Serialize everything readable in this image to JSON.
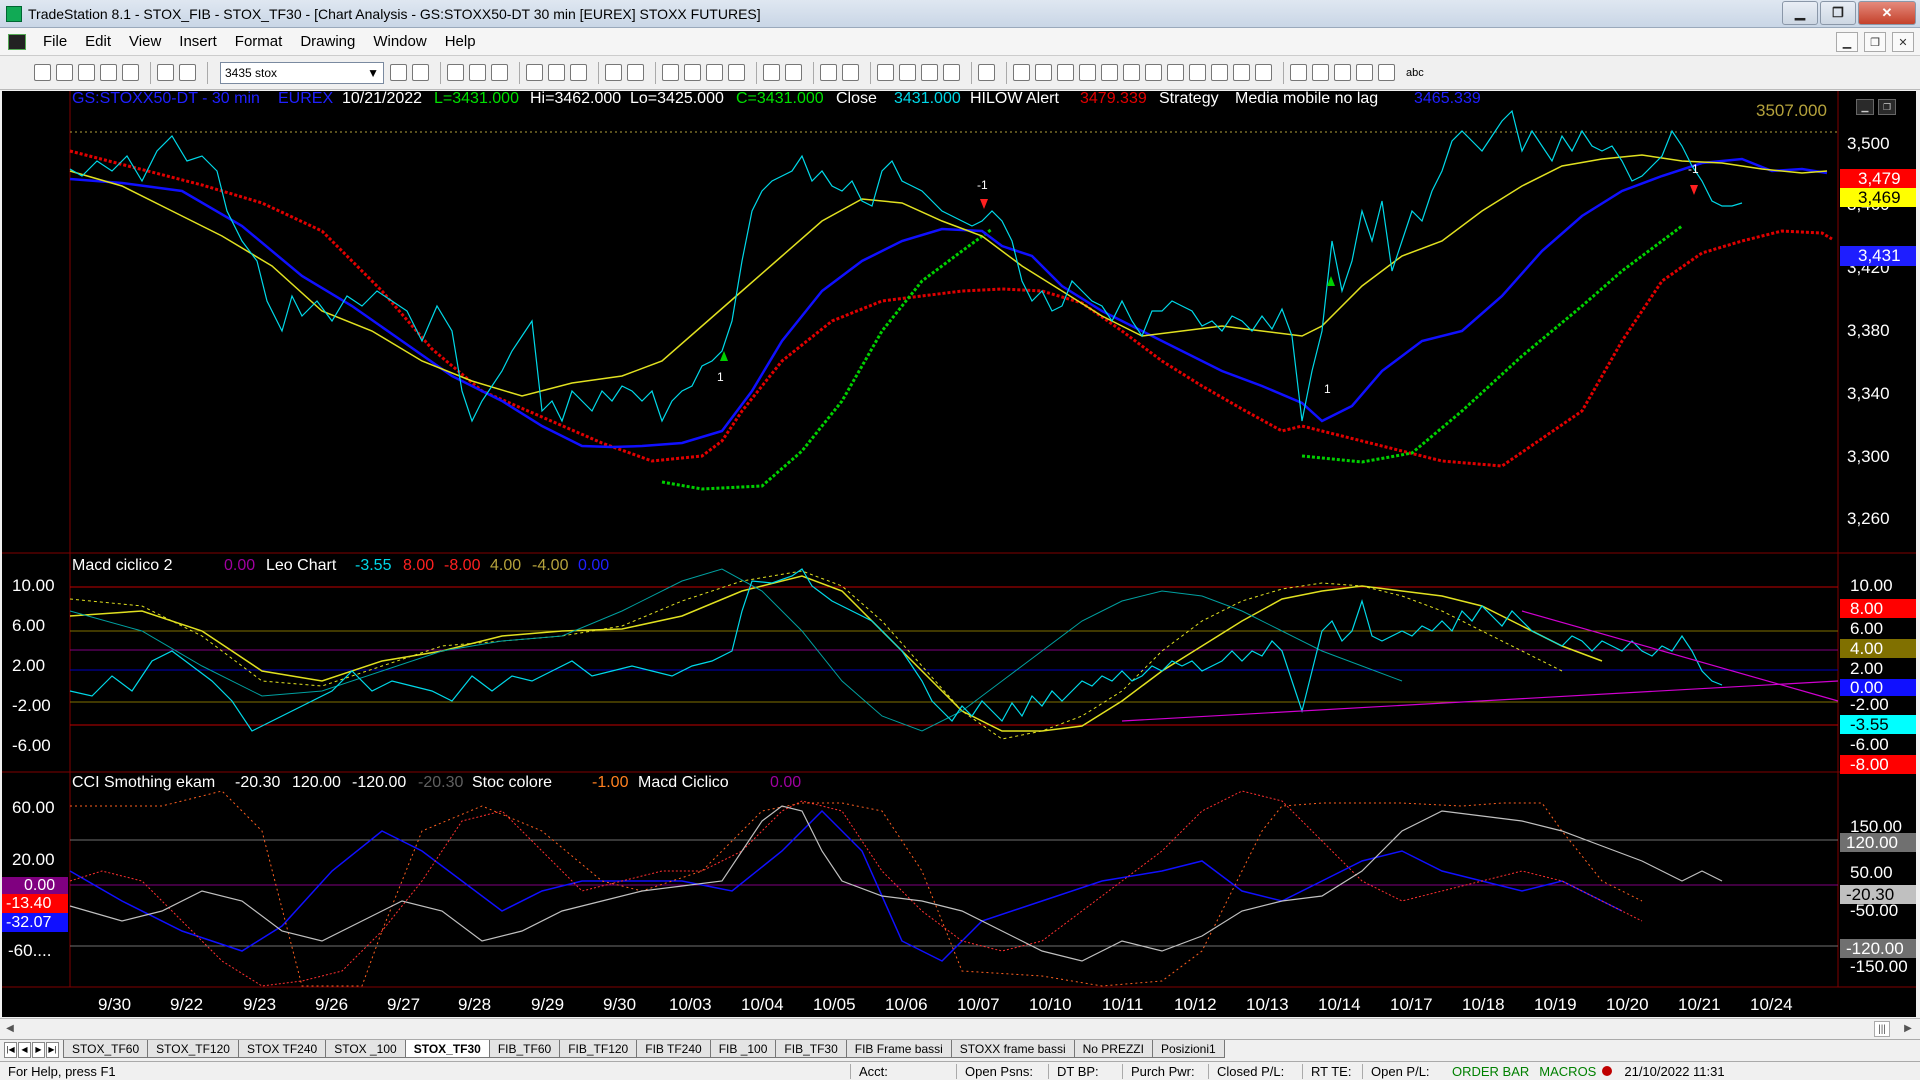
{
  "window": {
    "title": "TradeStation 8.1 - STOX_FIB - STOX_TF30 - [Chart Analysis - GS:STOXX50-DT  30 min  [EUREX] STOXX FUTURES]"
  },
  "menu": [
    "File",
    "Edit",
    "View",
    "Insert",
    "Format",
    "Drawing",
    "Window",
    "Help"
  ],
  "toolbar": {
    "symbol_value": "3435 stox",
    "text_tool": "abc"
  },
  "header": {
    "symbol": "GS:STOXX50-DT - 30 min",
    "exchange": "EUREX",
    "date": "10/21/2022",
    "last": "L=3431.000",
    "high": "Hi=3462.000",
    "low": "Lo=3425.000",
    "close_c": "C=3431.000",
    "close_label": "Close",
    "close_value": "3431.000",
    "hilow": "HILOW Alert",
    "hilow_value": "3479.339",
    "strategy": "Strategy",
    "media": "Media mobile no lag",
    "media_value": "3465.339",
    "topline_value": "3507.000"
  },
  "macd_header": {
    "name": "Macd ciclico 2",
    "v1": "0.00",
    "leo": "Leo Chart",
    "v2": "-3.55",
    "v3": "8.00",
    "v4": "-8.00",
    "v5": "4.00",
    "v6": "-4.00",
    "v7": "0.00"
  },
  "cci_header": {
    "name": "CCI Smothing ekam",
    "v1": "-20.30",
    "v2": "120.00",
    "v3": "-120.00",
    "v4": "-20.30",
    "stoc": "Stoc colore",
    "v5": "-1.00",
    "macd": "Macd Ciclico",
    "v6": "0.00"
  },
  "price_axis": [
    "3,500",
    "3,460",
    "3,420",
    "3,380",
    "3,340",
    "3,300",
    "3,260"
  ],
  "price_tags": {
    "red": "3,479",
    "yellow": "3,469",
    "blue": "3,431"
  },
  "macd_axis": [
    "10.00",
    "6.00",
    "2.00",
    "-2.00",
    "-6.00"
  ],
  "macd_tags": [
    "8.00",
    "4.00",
    "2.00",
    "0.00",
    "-2.00",
    "-3.55",
    "-6.00",
    "-8.00"
  ],
  "cci_axis": [
    "150.00",
    "120.00",
    "50.00",
    "-20.30",
    "-50.00",
    "-120.00",
    "-150.00"
  ],
  "cci_left_axis": [
    "60.00",
    "20.00",
    "-60...."
  ],
  "cci_left_tags": [
    "0.00",
    "-13.40",
    "-32.07"
  ],
  "time_axis": [
    "9/30",
    "9/22",
    "9/23",
    "9/26",
    "9/27",
    "9/28",
    "9/29",
    "9/30",
    "10/03",
    "10/04",
    "10/05",
    "10/06",
    "10/07",
    "10/10",
    "10/11",
    "10/12",
    "10/13",
    "10/14",
    "10/17",
    "10/18",
    "10/19",
    "10/20",
    "10/21",
    "10/24"
  ],
  "markers": {
    "buy": "1",
    "sell": "-1"
  },
  "tabs": [
    "STOX_TF60",
    "STOX_TF120",
    "STOX TF240",
    "STOX _100",
    "STOX_TF30",
    "FIB_TF60",
    "FIB_TF120",
    "FIB TF240",
    "FIB _100",
    "FIB_TF30",
    "FIB Frame bassi",
    "STOXX frame bassi",
    "No PREZZI",
    "Posizioni1"
  ],
  "active_tab": "STOX_TF30",
  "status": {
    "help": "For Help, press F1",
    "acct": "Acct:",
    "open_psns": "Open Psns:",
    "dt_bp": "DT BP:",
    "purch_pwr": "Purch Pwr:",
    "closed_pl": "Closed P/L:",
    "rt_te": "RT TE:",
    "open_pl": "Open P/L:",
    "orderbar": "ORDER BAR",
    "macros": "MACROS",
    "datetime": "21/10/2022 11:31"
  },
  "chart_data": {
    "type": "line",
    "title": "GS:STOXX50-DT - 30 min",
    "x": [
      "9/22",
      "9/23",
      "9/26",
      "9/27",
      "9/28",
      "9/29",
      "9/30",
      "10/03",
      "10/04",
      "10/05",
      "10/06",
      "10/07",
      "10/10",
      "10/11",
      "10/12",
      "10/13",
      "10/14",
      "10/17",
      "10/18",
      "10/19",
      "10/20",
      "10/21"
    ],
    "series": [
      {
        "name": "Close",
        "values": [
          3470,
          3440,
          3330,
          3360,
          3280,
          3270,
          3290,
          3300,
          3460,
          3440,
          3430,
          3400,
          3340,
          3320,
          3330,
          3300,
          3400,
          3440,
          3490,
          3470,
          3460,
          3431
        ]
      }
    ],
    "ylim": [
      3245,
      3520
    ]
  }
}
